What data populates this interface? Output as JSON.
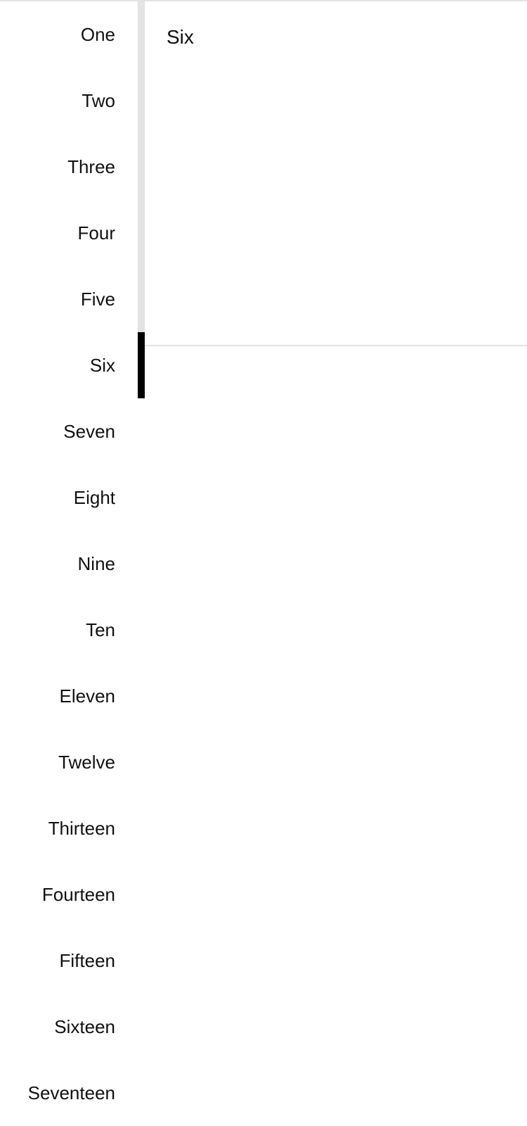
{
  "tabs": [
    {
      "label": "One"
    },
    {
      "label": "Two"
    },
    {
      "label": "Three"
    },
    {
      "label": "Four"
    },
    {
      "label": "Five"
    },
    {
      "label": "Six"
    },
    {
      "label": "Seven"
    },
    {
      "label": "Eight"
    },
    {
      "label": "Nine"
    },
    {
      "label": "Ten"
    },
    {
      "label": "Eleven"
    },
    {
      "label": "Twelve"
    },
    {
      "label": "Thirteen"
    },
    {
      "label": "Fourteen"
    },
    {
      "label": "Fifteen"
    },
    {
      "label": "Sixteen"
    },
    {
      "label": "Seventeen"
    }
  ],
  "selected_tab": "Six",
  "panel": {
    "content": "Six"
  },
  "colors": {
    "indicator": "#000000",
    "track": "#e3e3e3",
    "text": "#111111"
  }
}
